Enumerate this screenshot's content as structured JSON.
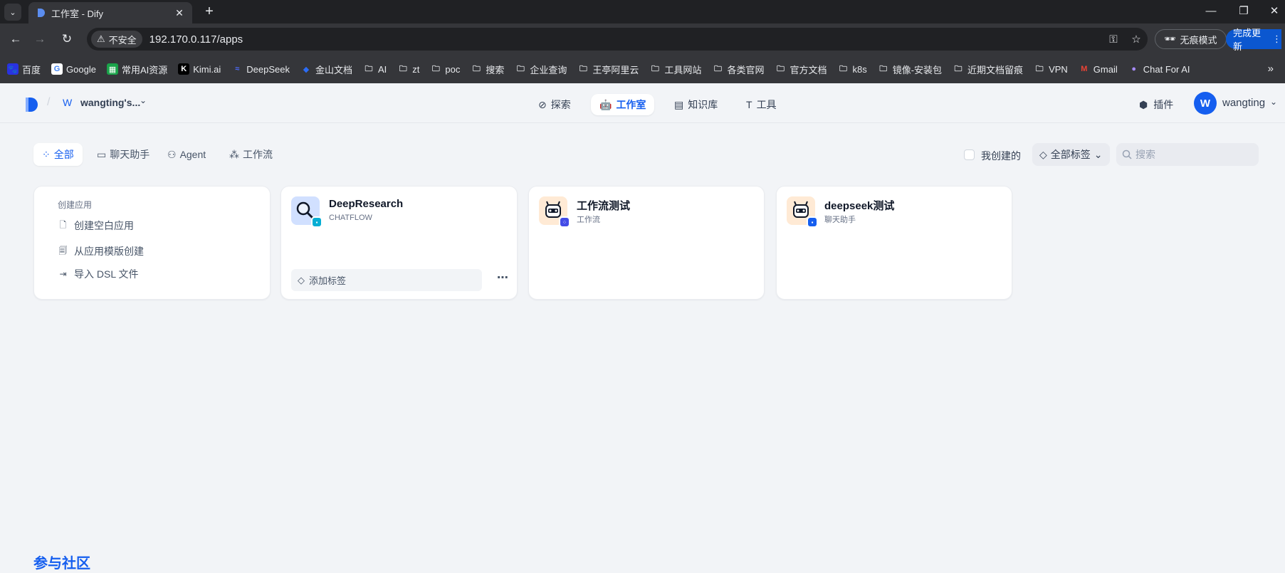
{
  "browser": {
    "tab_title": "工作室 - Dify",
    "url": "192.170.0.117/apps",
    "insecure_label": "不安全",
    "incognito_label": "无痕模式",
    "update_label": "完成更新",
    "bookmarks": [
      {
        "label": "百度",
        "icon": "baidu-icon"
      },
      {
        "label": "Google",
        "icon": "google-icon"
      },
      {
        "label": "常用AI资源",
        "icon": "bookmark-icon"
      },
      {
        "label": "Kimi.ai",
        "icon": "kimi-icon"
      },
      {
        "label": "DeepSeek",
        "icon": "deepseek-icon"
      },
      {
        "label": "金山文档",
        "icon": "kdocs-icon"
      },
      {
        "label": "AI",
        "icon": "folder-icon"
      },
      {
        "label": "zt",
        "icon": "folder-icon"
      },
      {
        "label": "poc",
        "icon": "folder-icon"
      },
      {
        "label": "搜索",
        "icon": "folder-icon"
      },
      {
        "label": "企业查询",
        "icon": "folder-icon"
      },
      {
        "label": "王亭阿里云",
        "icon": "folder-icon"
      },
      {
        "label": "工具网站",
        "icon": "folder-icon"
      },
      {
        "label": "各类官网",
        "icon": "folder-icon"
      },
      {
        "label": "官方文档",
        "icon": "folder-icon"
      },
      {
        "label": "k8s",
        "icon": "folder-icon"
      },
      {
        "label": "镜像-安装包",
        "icon": "folder-icon"
      },
      {
        "label": "近期文档留痕",
        "icon": "folder-icon"
      },
      {
        "label": "VPN",
        "icon": "folder-icon"
      },
      {
        "label": "Gmail",
        "icon": "gmail-icon"
      },
      {
        "label": "Chat For AI",
        "icon": "chat-ai-icon"
      }
    ]
  },
  "header": {
    "workspace_initial": "W",
    "workspace_name": "wangting's...",
    "nav": [
      {
        "label": "探索",
        "icon": "compass-icon"
      },
      {
        "label": "工作室",
        "icon": "robot-icon",
        "active": true
      },
      {
        "label": "知识库",
        "icon": "book-icon"
      },
      {
        "label": "工具",
        "icon": "hammer-icon"
      }
    ],
    "plugin_label": "插件",
    "user_initial": "W",
    "username": "wangting"
  },
  "filters": {
    "tabs": [
      {
        "label": "全部",
        "icon": "grid-icon",
        "active": true
      },
      {
        "label": "聊天助手",
        "icon": "chat-icon"
      },
      {
        "label": "Agent",
        "icon": "agent-icon"
      },
      {
        "label": "工作流",
        "icon": "workflow-icon"
      }
    ],
    "mine_label": "我创建的",
    "tag_filter_label": "全部标签",
    "search_placeholder": "搜索"
  },
  "create_card": {
    "title": "创建应用",
    "items": [
      "创建空白应用",
      "从应用模版创建",
      "导入 DSL 文件"
    ]
  },
  "apps": [
    {
      "name": "DeepResearch",
      "type": "CHATFLOW",
      "icon": "magnifier-icon",
      "icon_bg": "#d1e0ff",
      "badge_color": "#06aed4",
      "tag_label": "添加标签"
    },
    {
      "name": "工作流测试",
      "type": "工作流",
      "icon": "robot-avatar-icon",
      "icon_bg": "#ffead5",
      "badge_color": "#444ce7"
    },
    {
      "name": "deepseek测试",
      "type": "聊天助手",
      "icon": "robot-avatar-icon",
      "icon_bg": "#ffead5",
      "badge_color": "#155eef"
    }
  ],
  "community_title": "参与社区",
  "colors": {
    "accent": "#155eef",
    "page_bg": "#f2f4f7"
  }
}
